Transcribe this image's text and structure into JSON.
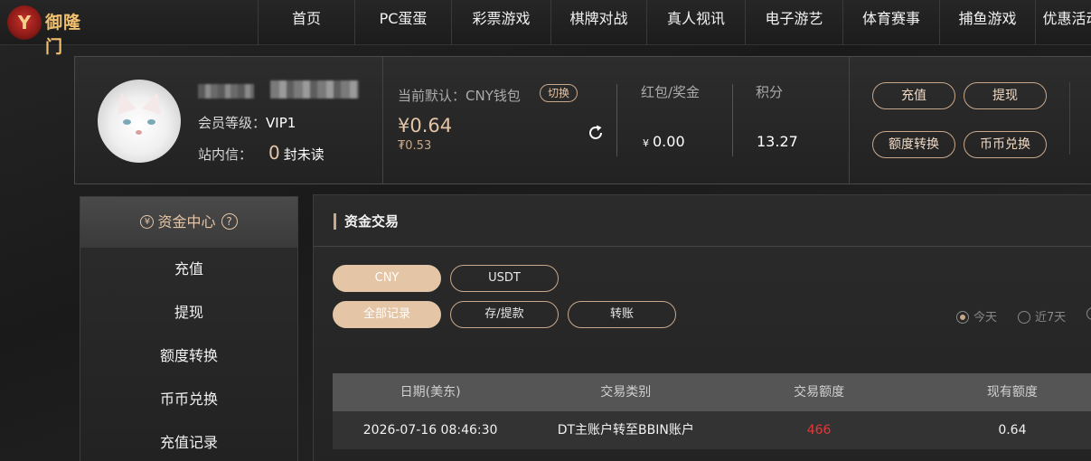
{
  "nav": {
    "logo_text": "御隆门",
    "logo_mark": "Y",
    "items": [
      {
        "label": "首页",
        "width": 107
      },
      {
        "label": "PC蛋蛋",
        "width": 107
      },
      {
        "label": "彩票游戏",
        "width": 110
      },
      {
        "label": "棋牌对战",
        "width": 106
      },
      {
        "label": "真人视讯",
        "width": 109
      },
      {
        "label": "电子游艺",
        "width": 108
      },
      {
        "label": "体育赛事",
        "width": 107
      },
      {
        "label": "捕鱼游戏",
        "width": 106
      },
      {
        "label": "优惠活动",
        "width": 80
      }
    ]
  },
  "profile": {
    "vip_label": "会员等级：",
    "vip_value": "VIP1",
    "msg_label": "站内信：",
    "msg_count": "0",
    "msg_unread": "封未读"
  },
  "wallet": {
    "label": "当前默认：CNY钱包",
    "switch_label": "切换",
    "balance": "¥0.64",
    "sub_balance": "₮0.53"
  },
  "stats": {
    "bonus_label": "红包/奖金",
    "bonus_currency": "¥",
    "bonus_value": "0.00",
    "points_label": "积分",
    "points_value": "13.27"
  },
  "actions": {
    "recharge": "充值",
    "withdraw": "提现",
    "transfer": "额度转换",
    "exchange": "币币兑换"
  },
  "sidebar": {
    "title": "资金中心",
    "yen_glyph": "¥",
    "help_glyph": "?",
    "items": [
      "充值",
      "提现",
      "额度转换",
      "币币兑换",
      "充值记录"
    ]
  },
  "main": {
    "title": "资金交易",
    "currency_tabs": [
      "CNY",
      "USDT"
    ],
    "type_tabs": [
      "全部记录",
      "存/提款",
      "转账"
    ],
    "range_options": [
      "今天",
      "近7天"
    ],
    "table": {
      "headers": [
        "日期(美东)",
        "交易类别",
        "交易额度",
        "现有额度"
      ],
      "rows": [
        [
          "2026-07-16 08:46:30",
          "DT主账户转至BBIN账户",
          "466",
          "0.64"
        ]
      ]
    }
  }
}
